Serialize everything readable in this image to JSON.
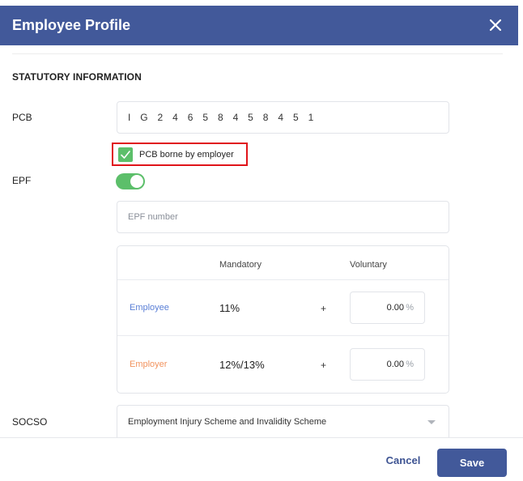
{
  "header": {
    "title": "Employee Profile",
    "close_icon": "close-icon"
  },
  "statutory": {
    "section_title": "STATUTORY INFORMATION",
    "pcb": {
      "label": "PCB",
      "value": "I G 2 4 6 5 8 4 5 8 4 5 1",
      "borne_checked": true,
      "borne_label": "PCB borne by employer"
    },
    "epf": {
      "label": "EPF",
      "enabled": true,
      "number_placeholder": "EPF number",
      "number_value": "",
      "table": {
        "col_mandatory": "Mandatory",
        "col_voluntary": "Voluntary",
        "rows": [
          {
            "role": "Employee",
            "mandatory": "11%",
            "plus": "+",
            "voluntary": "0.00",
            "unit": "%"
          },
          {
            "role": "Employer",
            "mandatory": "12%/13%",
            "plus": "+",
            "voluntary": "0.00",
            "unit": "%"
          }
        ]
      }
    },
    "socso": {
      "label": "SOCSO",
      "selected": "Employment Injury Scheme and Invalidity Scheme"
    }
  },
  "footer": {
    "cancel_label": "Cancel",
    "save_label": "Save"
  },
  "colors": {
    "header_bg": "#42599a",
    "toggle_on": "#5cbf6a",
    "highlight_border": "#e0141a",
    "employee_label": "#5a7fd6",
    "employer_label": "#f2935e"
  }
}
